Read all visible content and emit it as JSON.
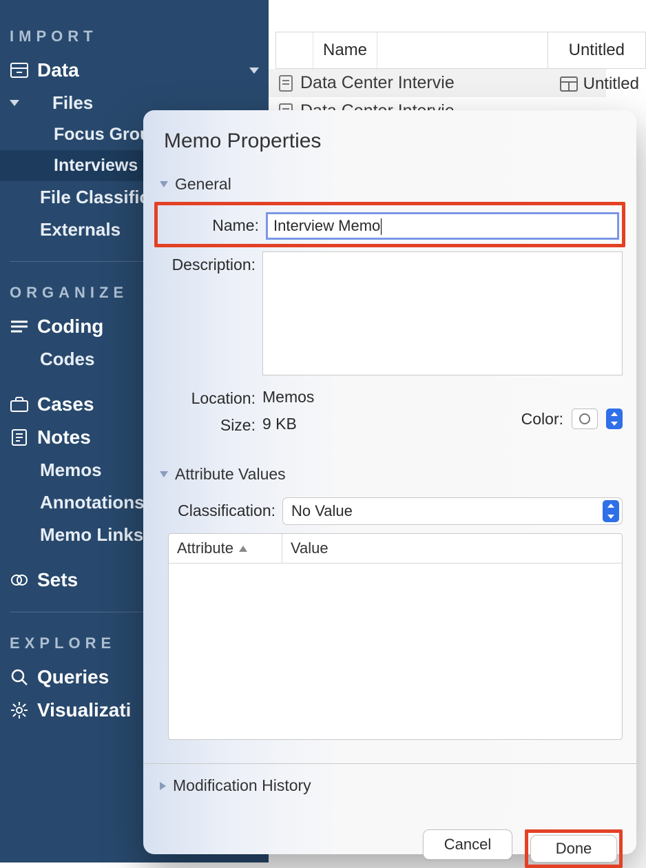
{
  "sidebar": {
    "sections": {
      "import_heading": "IMPORT",
      "organize_heading": "ORGANIZE",
      "explore_heading": "EXPLORE"
    },
    "data_label": "Data",
    "files_label": "Files",
    "focus_group_label": "Focus Grou",
    "interviews_label": "Interviews",
    "file_classifications_label": "File Classifica",
    "externals_label": "Externals",
    "coding_label": "Coding",
    "codes_label": "Codes",
    "cases_label": "Cases",
    "notes_label": "Notes",
    "memos_label": "Memos",
    "annotations_label": "Annotations",
    "memo_links_label": "Memo Links",
    "sets_label": "Sets",
    "queries_label": "Queries",
    "visualizations_label": "Visualizati"
  },
  "list": {
    "header_name": "Name",
    "rows": [
      "Data Center Intervie",
      "Data Center Intervie"
    ],
    "tab_label": "Untitled",
    "open_doc_label": "Untitled"
  },
  "dialog": {
    "title": "Memo Properties",
    "general": {
      "heading": "General",
      "name_label": "Name:",
      "name_value": "Interview Memo",
      "description_label": "Description:",
      "location_label": "Location:",
      "location_value": "Memos",
      "size_label": "Size:",
      "size_value": "9 KB",
      "color_label": "Color:"
    },
    "attributes": {
      "heading": "Attribute Values",
      "classification_label": "Classification:",
      "classification_value": "No Value",
      "col_attribute": "Attribute",
      "col_value": "Value"
    },
    "mod_history_heading": "Modification History",
    "buttons": {
      "cancel": "Cancel",
      "done": "Done"
    }
  }
}
